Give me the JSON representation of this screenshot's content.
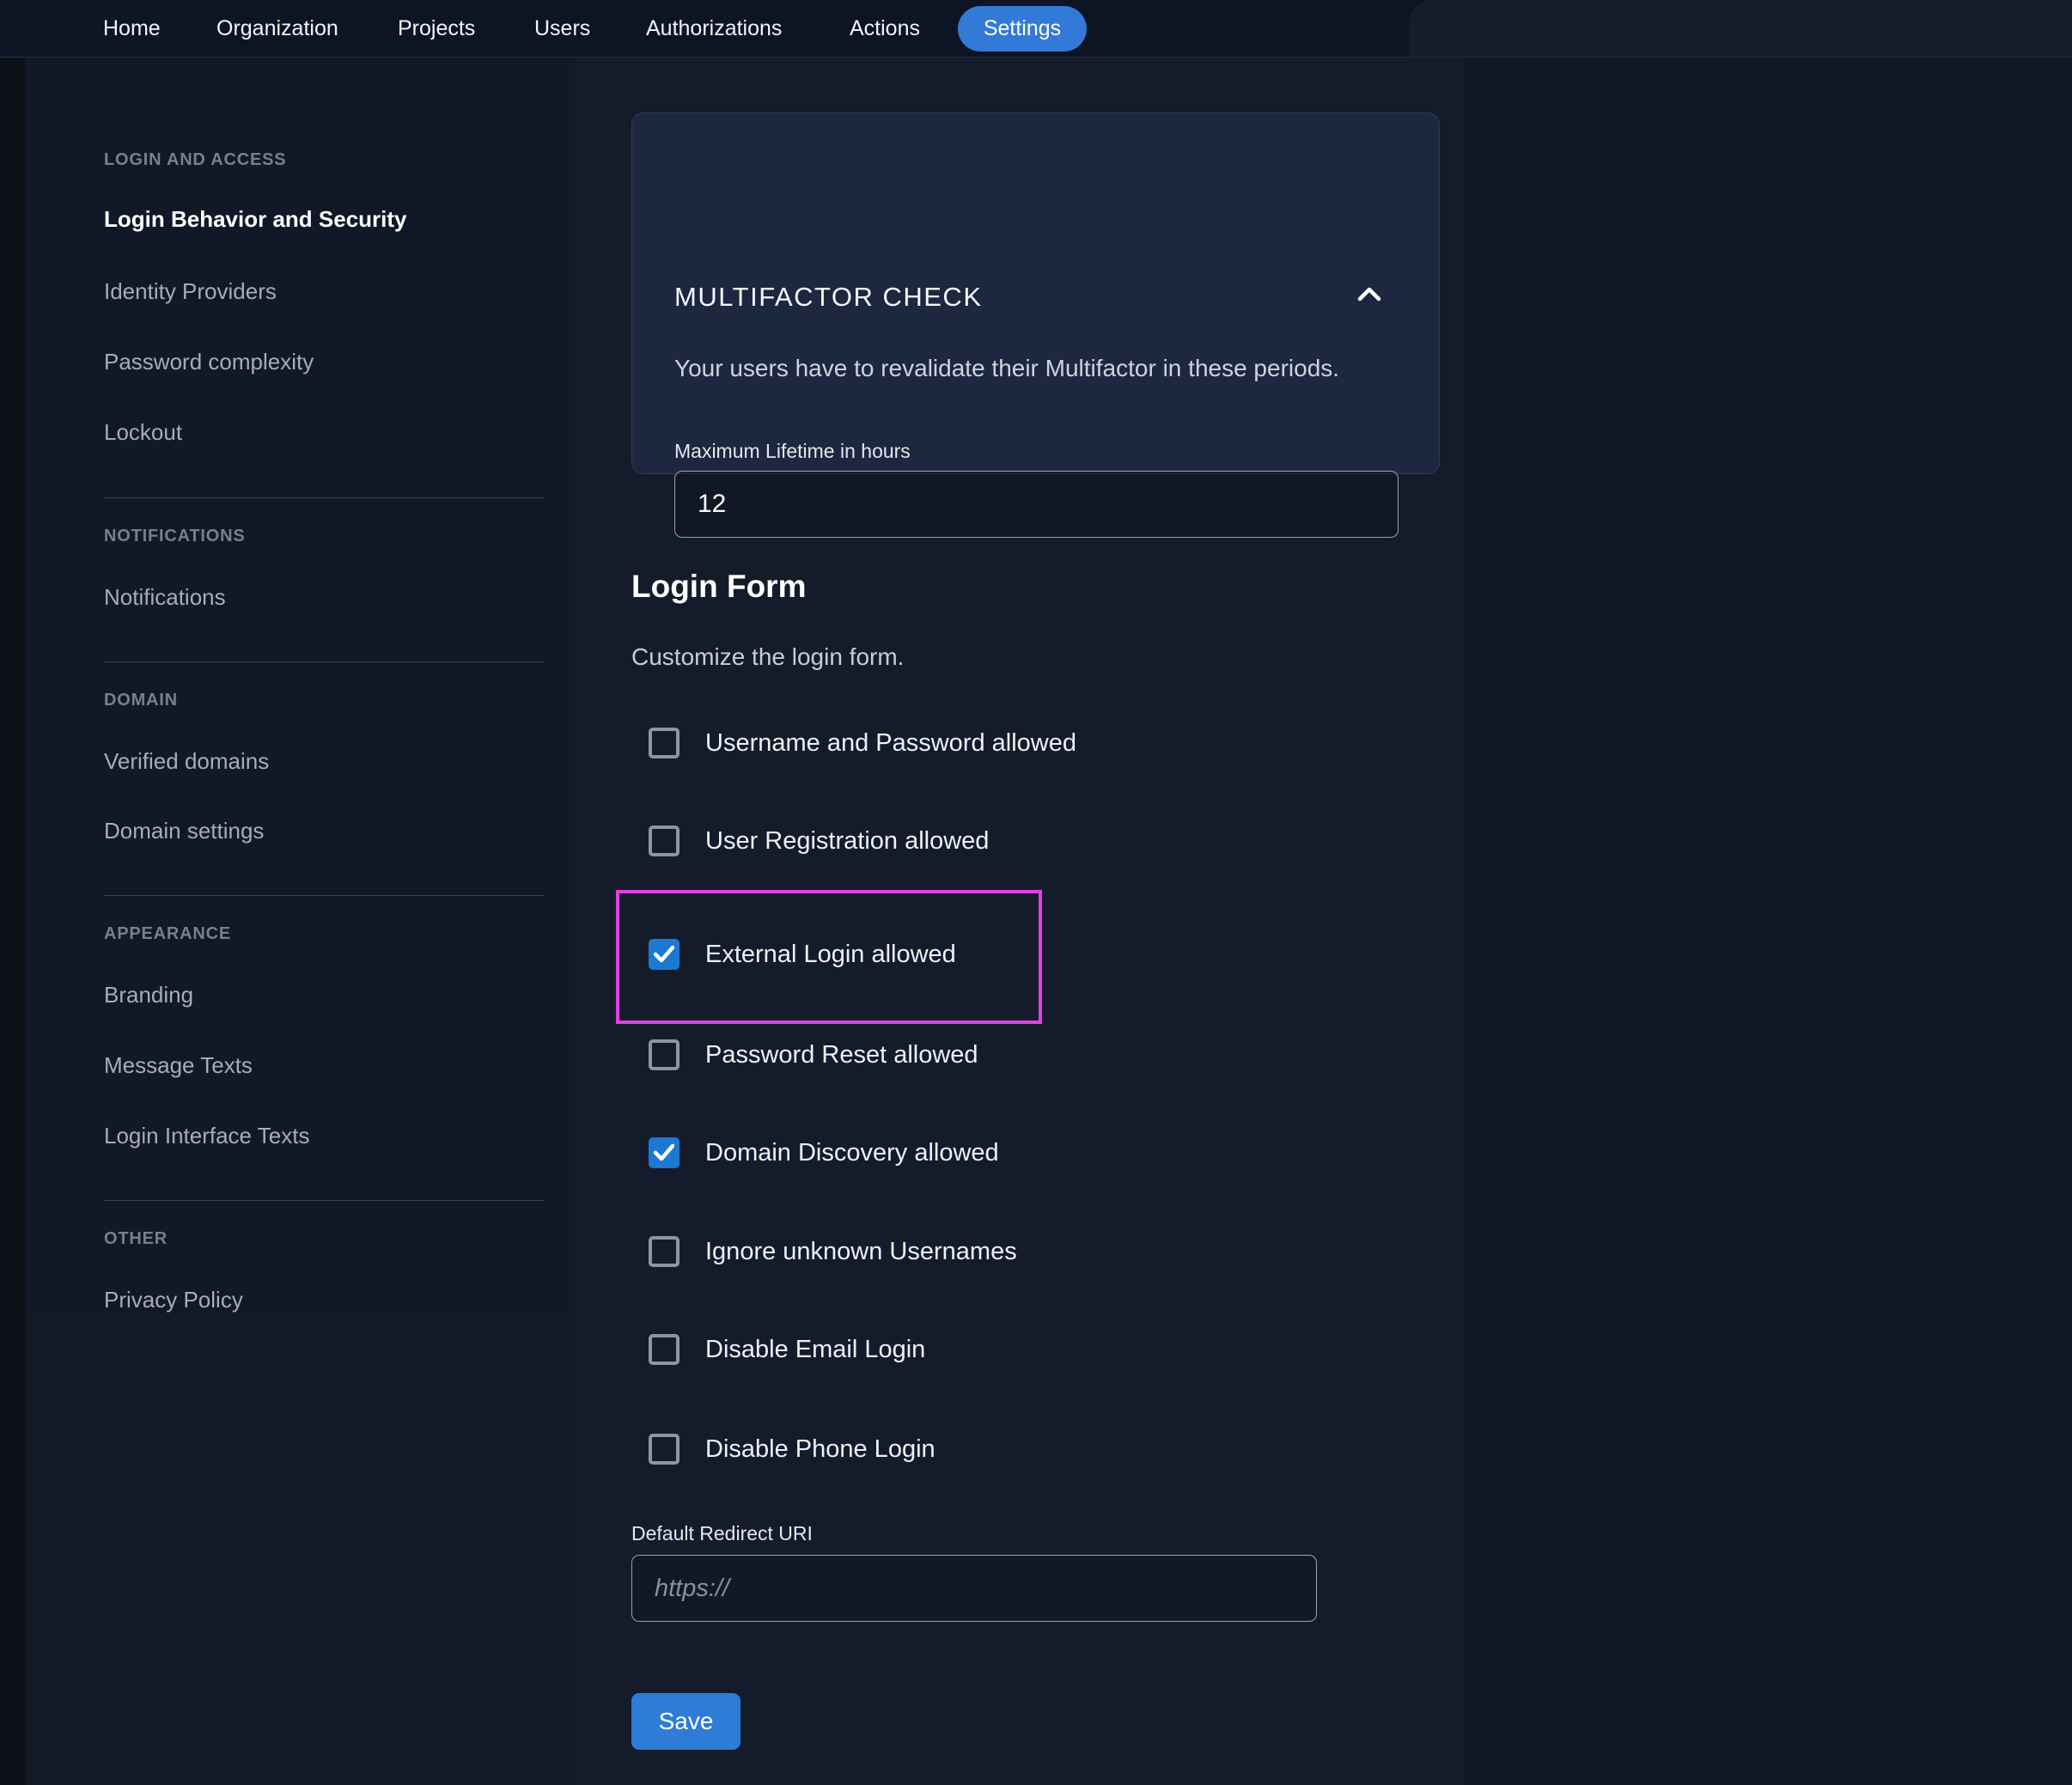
{
  "nav": {
    "items": [
      {
        "label": "Home"
      },
      {
        "label": "Organization"
      },
      {
        "label": "Projects"
      },
      {
        "label": "Users"
      },
      {
        "label": "Authorizations"
      },
      {
        "label": "Actions"
      },
      {
        "label": "Settings"
      }
    ],
    "active_item": "Settings"
  },
  "sidebar": {
    "sections": [
      {
        "header": "LOGIN AND ACCESS",
        "items": [
          {
            "label": "Login Behavior and Security",
            "active": true
          },
          {
            "label": "Identity Providers",
            "active": false
          },
          {
            "label": "Password complexity",
            "active": false
          },
          {
            "label": "Lockout",
            "active": false
          }
        ]
      },
      {
        "header": "NOTIFICATIONS",
        "items": [
          {
            "label": "Notifications",
            "active": false
          }
        ]
      },
      {
        "header": "DOMAIN",
        "items": [
          {
            "label": "Verified domains",
            "active": false
          },
          {
            "label": "Domain settings",
            "active": false
          }
        ]
      },
      {
        "header": "APPEARANCE",
        "items": [
          {
            "label": "Branding",
            "active": false
          },
          {
            "label": "Message Texts",
            "active": false
          },
          {
            "label": "Login Interface Texts",
            "active": false
          }
        ]
      },
      {
        "header": "OTHER",
        "items": [
          {
            "label": "Privacy Policy",
            "active": false
          }
        ]
      }
    ]
  },
  "mfa_card": {
    "title": "MULTIFACTOR CHECK",
    "collapse_icon": "chevron-up",
    "description": "Your users have to revalidate their Multifactor in these periods.",
    "lifetime_label": "Maximum Lifetime in hours",
    "lifetime_value": "12"
  },
  "login_form": {
    "title": "Login Form",
    "subtitle": "Customize the login form.",
    "checkboxes": [
      {
        "label": "Username and Password allowed",
        "checked": false
      },
      {
        "label": "User Registration allowed",
        "checked": false
      },
      {
        "label": "External Login allowed",
        "checked": true,
        "highlighted": true
      },
      {
        "label": "Password Reset allowed",
        "checked": false
      },
      {
        "label": "Domain Discovery allowed",
        "checked": true
      },
      {
        "label": "Ignore unknown Usernames",
        "checked": false
      },
      {
        "label": "Disable Email Login",
        "checked": false
      },
      {
        "label": "Disable Phone Login",
        "checked": false
      }
    ],
    "redirect_label": "Default Redirect URI",
    "redirect_placeholder": "https://",
    "save_label": "Save"
  },
  "colors": {
    "accent_blue": "#3379d8",
    "checkbox_checked_blue": "#1b79d3",
    "highlight_magenta": "#e43ee9",
    "card_background": "#1e2740",
    "page_background": "#0d1423"
  }
}
